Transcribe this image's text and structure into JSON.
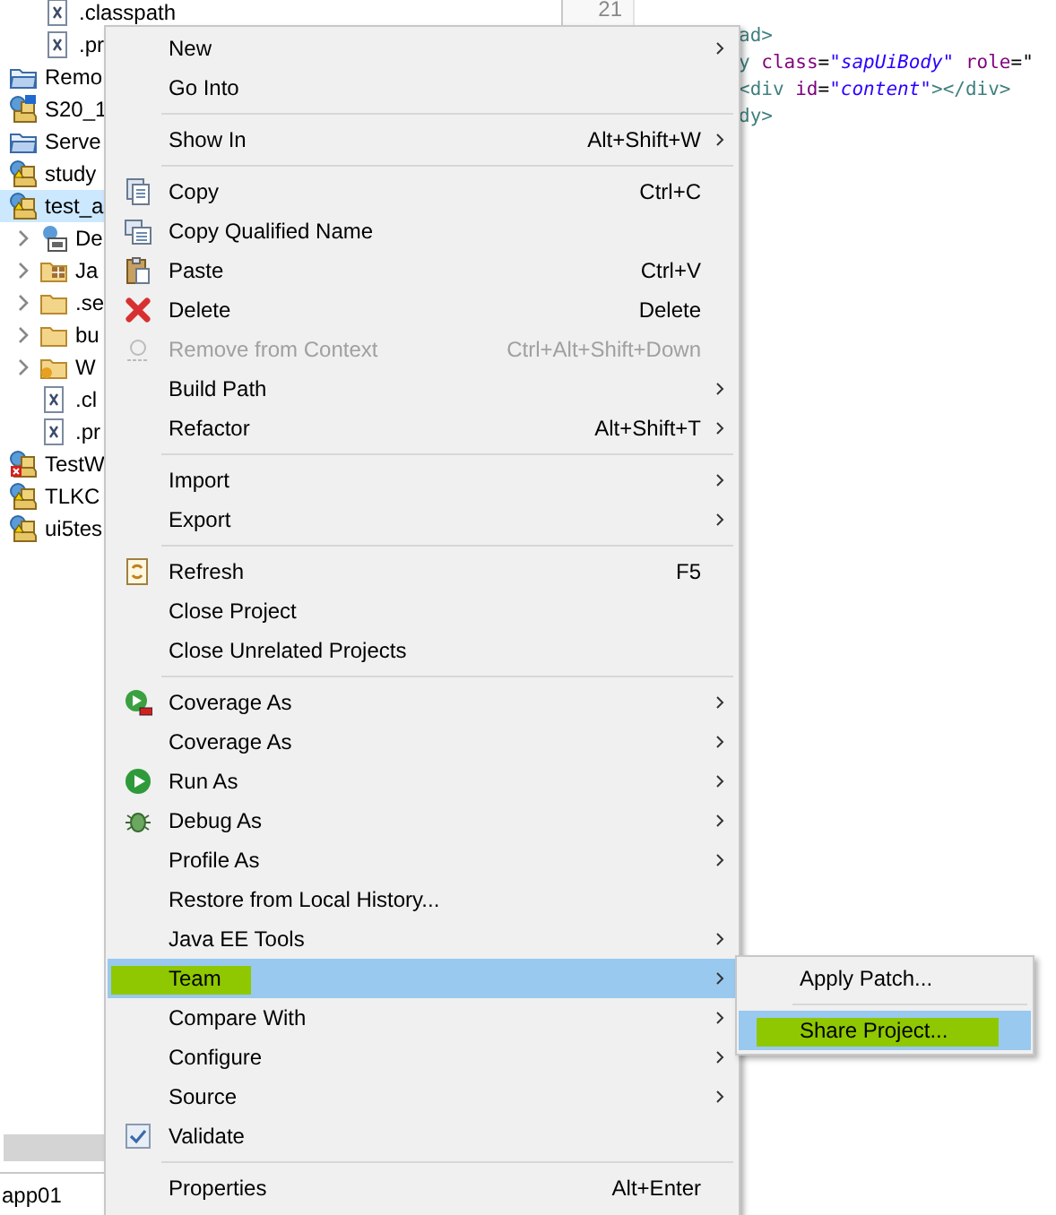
{
  "tree": {
    "continued_children": [
      {
        "label": ".classpath",
        "kind": "file"
      },
      {
        "label": ".pr",
        "kind": "file"
      }
    ],
    "items": [
      {
        "label": "Remo",
        "kind": "folder-project",
        "selected": false
      },
      {
        "label": "S20_1",
        "kind": "server-project",
        "selected": false
      },
      {
        "label": "Serve",
        "kind": "folder-project",
        "selected": false
      },
      {
        "label": "study",
        "kind": "project",
        "selected": false
      },
      {
        "label": "test_a",
        "kind": "project",
        "selected": true,
        "children": [
          {
            "label": "De",
            "kind": "descriptor",
            "expandable": true
          },
          {
            "label": "Ja",
            "kind": "java",
            "expandable": true
          },
          {
            "label": ".se",
            "kind": "folder",
            "expandable": true
          },
          {
            "label": "bu",
            "kind": "folder",
            "expandable": true
          },
          {
            "label": "W",
            "kind": "web-folder",
            "expandable": true
          },
          {
            "label": ".cl",
            "kind": "file",
            "expandable": false
          },
          {
            "label": ".pr",
            "kind": "file",
            "expandable": false
          }
        ]
      },
      {
        "label": "TestW",
        "kind": "error-project",
        "selected": false
      },
      {
        "label": "TLKC",
        "kind": "project",
        "selected": false
      },
      {
        "label": "ui5tes",
        "kind": "project",
        "selected": false
      }
    ]
  },
  "bottom_tab": {
    "label": "app01"
  },
  "editor": {
    "line_number": "21",
    "lines": [
      [
        {
          "kind": "tag",
          "s": "ad>"
        }
      ],
      [
        {
          "kind": "tag",
          "s": "y "
        },
        {
          "kind": "attr",
          "s": "class"
        },
        {
          "kind": "plain",
          "s": "="
        },
        {
          "kind": "value",
          "s": "\"sapUiBody\" "
        },
        {
          "kind": "attr",
          "s": "role"
        },
        {
          "kind": "plain",
          "s": "=\""
        }
      ],
      [
        {
          "kind": "tag",
          "s": "<div "
        },
        {
          "kind": "attr",
          "s": "id"
        },
        {
          "kind": "plain",
          "s": "="
        },
        {
          "kind": "value",
          "s": "\"content\""
        },
        {
          "kind": "tag",
          "s": "></div>"
        }
      ],
      [
        {
          "kind": "tag",
          "s": "dy>"
        }
      ]
    ]
  },
  "context_menu": [
    {
      "kind": "plain",
      "label": "New",
      "submenu": true
    },
    {
      "kind": "plain",
      "label": "Go Into"
    },
    {
      "kind": "separator"
    },
    {
      "kind": "plain",
      "label": "Show In",
      "shortcut": "Alt+Shift+W",
      "submenu": true
    },
    {
      "kind": "separator"
    },
    {
      "kind": "copy",
      "label": "Copy",
      "shortcut": "Ctrl+C"
    },
    {
      "kind": "copy-qualified",
      "label": "Copy Qualified Name"
    },
    {
      "kind": "paste",
      "label": "Paste",
      "shortcut": "Ctrl+V"
    },
    {
      "kind": "delete",
      "label": "Delete",
      "shortcut": "Delete"
    },
    {
      "kind": "remove",
      "label": "Remove from Context",
      "shortcut": "Ctrl+Alt+Shift+Down",
      "disabled": true
    },
    {
      "kind": "plain",
      "label": "Build Path",
      "submenu": true
    },
    {
      "kind": "plain",
      "label": "Refactor",
      "shortcut": "Alt+Shift+T",
      "submenu": true
    },
    {
      "kind": "separator"
    },
    {
      "kind": "plain",
      "label": "Import",
      "submenu": true
    },
    {
      "kind": "plain",
      "label": "Export",
      "submenu": true
    },
    {
      "kind": "separator"
    },
    {
      "kind": "refresh",
      "label": "Refresh",
      "shortcut": "F5"
    },
    {
      "kind": "plain",
      "label": "Close Project"
    },
    {
      "kind": "plain",
      "label": "Close Unrelated Projects"
    },
    {
      "kind": "separator"
    },
    {
      "kind": "coverage",
      "label": "Coverage As",
      "submenu": true
    },
    {
      "kind": "plain",
      "label": "Coverage As",
      "submenu": true
    },
    {
      "kind": "run",
      "label": "Run As",
      "submenu": true
    },
    {
      "kind": "debug",
      "label": "Debug As",
      "submenu": true
    },
    {
      "kind": "plain",
      "label": "Profile As",
      "submenu": true
    },
    {
      "kind": "plain",
      "label": "Restore from Local History..."
    },
    {
      "kind": "plain",
      "label": "Java EE Tools",
      "submenu": true
    },
    {
      "kind": "plain",
      "label": "Team",
      "submenu": true,
      "selected": true,
      "marked": true
    },
    {
      "kind": "plain",
      "label": "Compare With",
      "submenu": true
    },
    {
      "kind": "plain",
      "label": "Configure",
      "submenu": true
    },
    {
      "kind": "plain",
      "label": "Source",
      "submenu": true
    },
    {
      "kind": "check",
      "label": "Validate"
    },
    {
      "kind": "separator"
    },
    {
      "kind": "plain",
      "label": "Properties",
      "shortcut": "Alt+Enter"
    }
  ],
  "submenu": [
    {
      "kind": "plain",
      "label": "Apply Patch...",
      "selected": false,
      "marked": false
    },
    {
      "kind": "separator"
    },
    {
      "kind": "plain",
      "label": "Share Project...",
      "selected": true,
      "marked": true
    }
  ]
}
